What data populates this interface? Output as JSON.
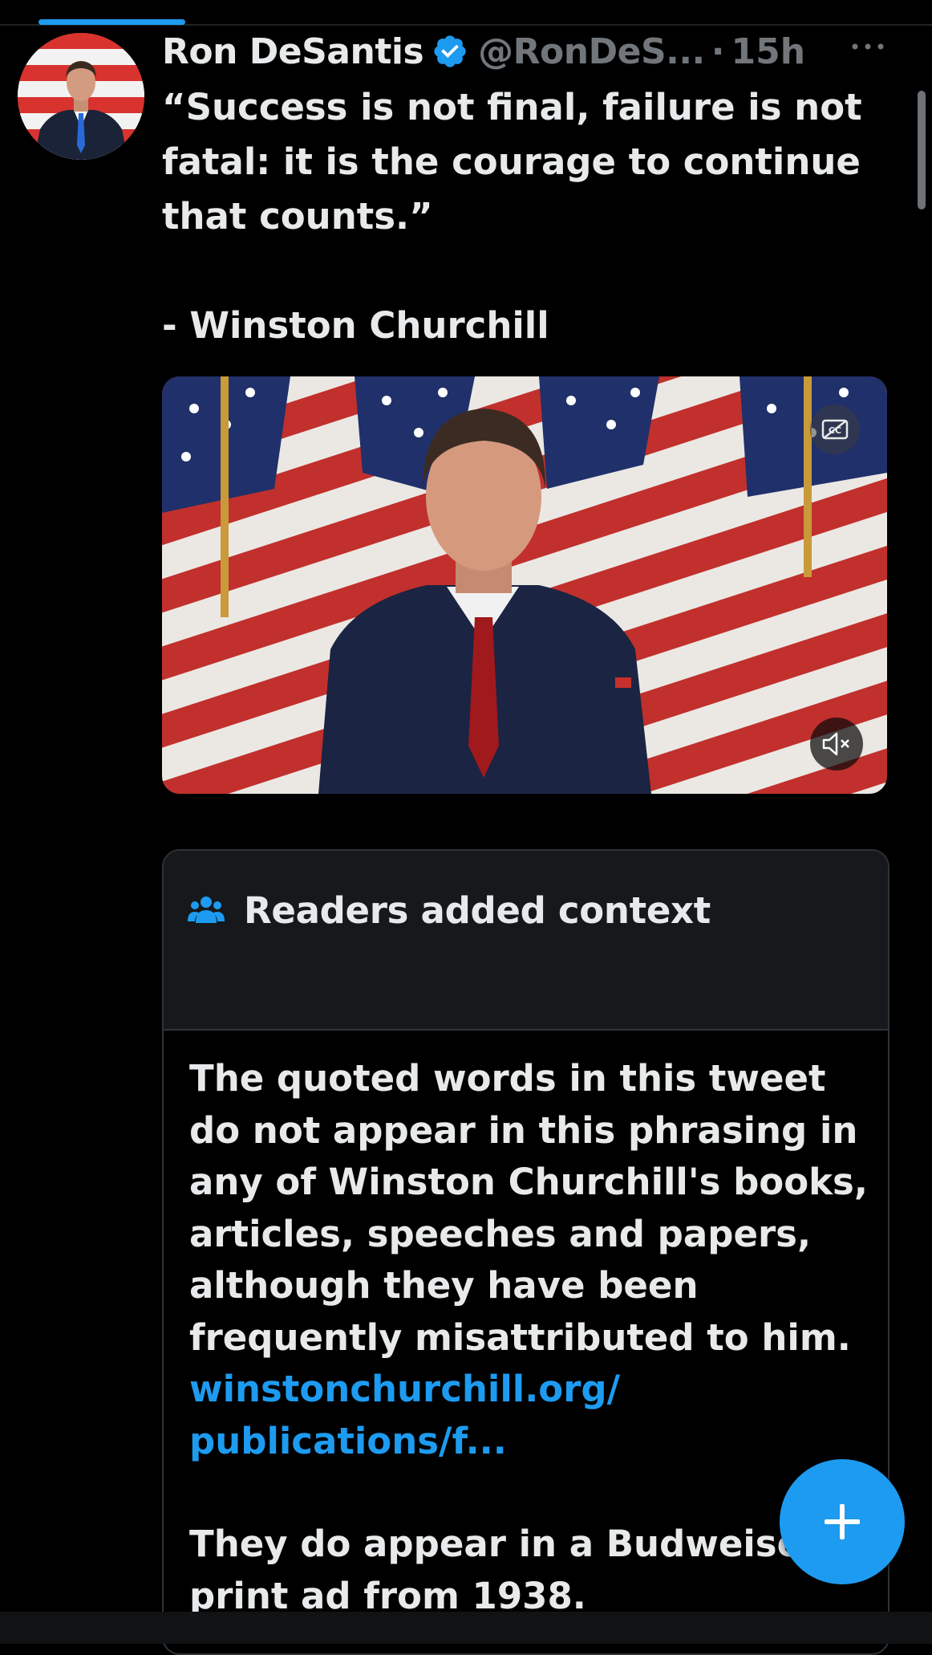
{
  "tweet": {
    "author_name": "Ron DeSantis",
    "author_handle": "@RonDeS...",
    "separator": "·",
    "timestamp": "15h",
    "text": "“Success is not final, failure is not\nfatal: it is the courage to continue\nthat counts.”\n\n- Winston Churchill"
  },
  "media": {
    "type": "video",
    "captions_icon": "closed-captions-icon",
    "mute_icon": "speaker-muted-icon"
  },
  "community_note": {
    "title": "Readers added context",
    "icon": "people-icon",
    "paragraph_1": "The quoted words in this tweet do not appear in this phrasing in any of Winston Churchill's books, articles, speeches and papers, although they have been frequently misattributed to him.",
    "link_line_1": "winstonchurchill.org/",
    "link_line_2": "publications/f...",
    "paragraph_2": "They do appear in a Budweiser print ad from 1938."
  },
  "fab": {
    "icon": "plus-icon"
  },
  "colors": {
    "accent": "#1d9bf0",
    "background": "#000000",
    "text_primary": "#e7e9ea",
    "text_secondary": "#71767b",
    "card_header": "#16181c",
    "border": "#2f3336"
  }
}
